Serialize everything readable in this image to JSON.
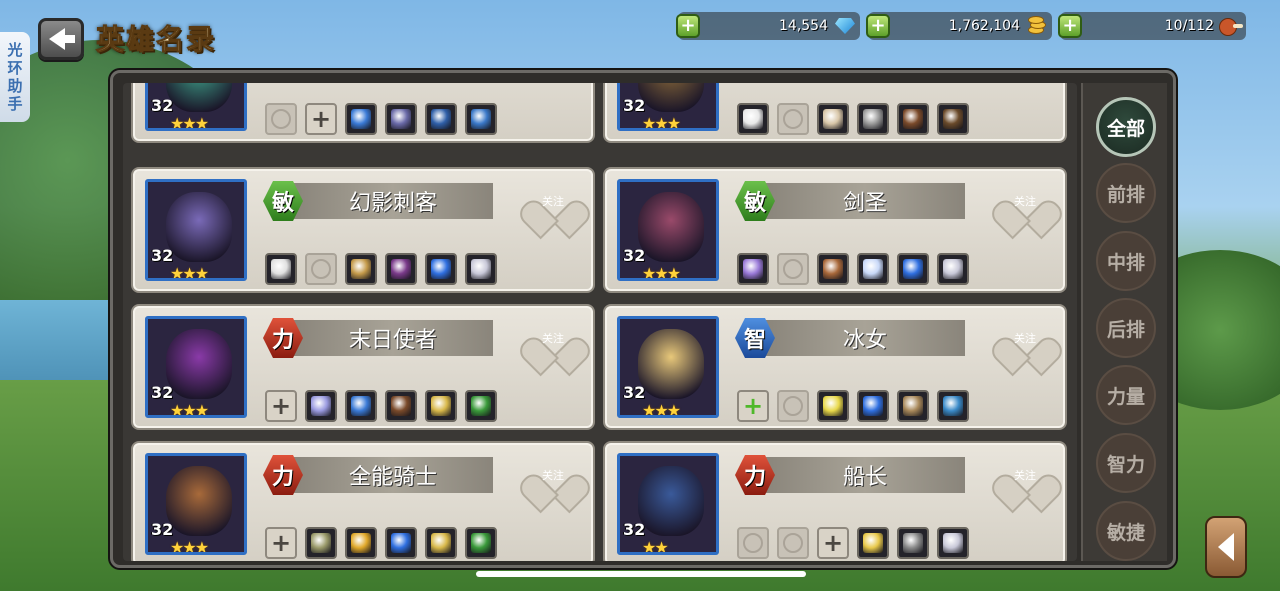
{
  "header": {
    "title": "英雄名录",
    "helper_tab": [
      "光",
      "环",
      "助",
      "手"
    ]
  },
  "resources": {
    "gems": "14,554",
    "gold": "1,762,104",
    "stamina": "10/112",
    "add_label": "+"
  },
  "filters": [
    "全部",
    "前排",
    "中排",
    "后排",
    "力量",
    "智力",
    "敏捷"
  ],
  "follow_label": "关注",
  "heroes": [
    {
      "name": "",
      "class": "",
      "level": "32",
      "stars": "★★★",
      "face": "#3fa28a",
      "slots": [
        "empty",
        "add",
        "i:#3a7ad6",
        "i:#6a6aa8",
        "i:#2f5fa8",
        "i:#3a78c8"
      ]
    },
    {
      "name": "",
      "class": "",
      "level": "32",
      "stars": "★★★",
      "face": "#8a6a3a",
      "slots": [
        "i:#e8e8e8",
        "empty",
        "i:#d8c6a8",
        "i:#9a9a9a",
        "i:#7a4a2a",
        "i:#6a4a2a"
      ]
    },
    {
      "name": "幻影刺客",
      "class": "敏",
      "cls": "agi",
      "level": "32",
      "stars": "★★★",
      "face": "#7a6ab8",
      "slots": [
        "i:#e0e0e0",
        "empty",
        "i:#c49a4a",
        "i:#7a3a8a",
        "i:#2f6fe0",
        "i:#c8c8d8"
      ]
    },
    {
      "name": "剑圣",
      "class": "敏",
      "cls": "agi",
      "level": "32",
      "stars": "★★★",
      "face": "#9a4a6a",
      "slots": [
        "i:#9a7ad8",
        "empty",
        "i:#a8683a",
        "i:#c8d8f8",
        "i:#2f6fe0",
        "i:#c8c8d8"
      ]
    },
    {
      "name": "末日使者",
      "class": "力",
      "cls": "str",
      "level": "32",
      "stars": "★★★",
      "face": "#8a3aa8",
      "slots": [
        "add",
        "i:#9a9ae0",
        "i:#3a7ad6",
        "i:#7a4a2a",
        "i:#d8b84a",
        "i:#3a9a3a"
      ]
    },
    {
      "name": "冰女",
      "class": "智",
      "cls": "int",
      "level": "32",
      "stars": "★★★",
      "face": "#e8c87a",
      "slots": [
        "addg",
        "empty",
        "i:#e8d84a",
        "i:#2f6fe0",
        "i:#a8885a",
        "i:#3a8ac8"
      ]
    },
    {
      "name": "全能骑士",
      "class": "力",
      "cls": "str",
      "level": "32",
      "stars": "★★★",
      "face": "#a86a3a",
      "slots": [
        "add",
        "i:#9a9a6a",
        "i:#e0a82a",
        "i:#2f6fe0",
        "i:#d8b84a",
        "i:#3a9a3a"
      ]
    },
    {
      "name": "船长",
      "class": "力",
      "cls": "str",
      "level": "32",
      "stars": "★★",
      "face": "#3a5a9a",
      "slots": [
        "empty",
        "empty",
        "add",
        "i:#e8c84a",
        "i:#8a8a8a",
        "i:#c8c8d8"
      ]
    }
  ]
}
